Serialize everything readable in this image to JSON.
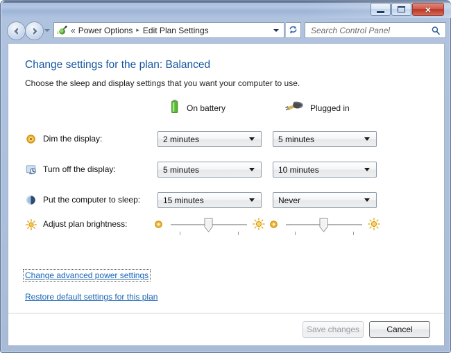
{
  "window": {
    "title": "",
    "buttons": {
      "minimize": "minimize-button",
      "maximize": "maximize-button",
      "close": "×"
    }
  },
  "nav": {
    "back": "back-button",
    "forward": "forward-button",
    "history_dropdown": "recent-pages-dropdown",
    "address_icon": "power-plug-icon",
    "chevrons": "«",
    "breadcrumbs": [
      {
        "label": "Power Options"
      },
      {
        "label": "Edit Plan Settings"
      }
    ],
    "breadcrumb_separator": "▸",
    "address_dropdown": "previous-locations-dropdown",
    "refresh": "refresh-icon"
  },
  "search": {
    "placeholder": "Search Control Panel",
    "icon": "search-icon"
  },
  "page": {
    "title": "Change settings for the plan: Balanced",
    "subtitle": "Choose the sleep and display settings that you want your computer to use."
  },
  "columns": [
    {
      "key": "battery",
      "label": "On battery",
      "icon": "battery-icon"
    },
    {
      "key": "plugged",
      "label": "Plugged in",
      "icon": "power-plug-icon"
    }
  ],
  "settings": [
    {
      "icon": "dim-display-icon",
      "label": "Dim the display:",
      "battery": "2 minutes",
      "plugged": "5 minutes",
      "control": "combo"
    },
    {
      "icon": "turn-off-display-icon",
      "label": "Turn off the display:",
      "battery": "5 minutes",
      "plugged": "10 minutes",
      "control": "combo"
    },
    {
      "icon": "sleep-icon",
      "label": "Put the computer to sleep:",
      "battery": "15 minutes",
      "plugged": "Never",
      "control": "combo"
    },
    {
      "icon": "brightness-icon",
      "label": "Adjust plan brightness:",
      "battery": "50",
      "plugged": "50",
      "control": "slider"
    }
  ],
  "links": [
    {
      "label": "Change advanced power settings",
      "focused": true
    },
    {
      "label": "Restore default settings for this plan",
      "focused": false
    }
  ],
  "footer": {
    "save_label": "Save changes",
    "save_enabled": false,
    "cancel_label": "Cancel",
    "cancel_enabled": true
  },
  "colors": {
    "heading": "#14559e",
    "link": "#1763b5",
    "frame": "#a9bedb",
    "close_button": "#ba3626",
    "battery_green": "#5fbb41",
    "brightness_gold": "#e8a317"
  }
}
